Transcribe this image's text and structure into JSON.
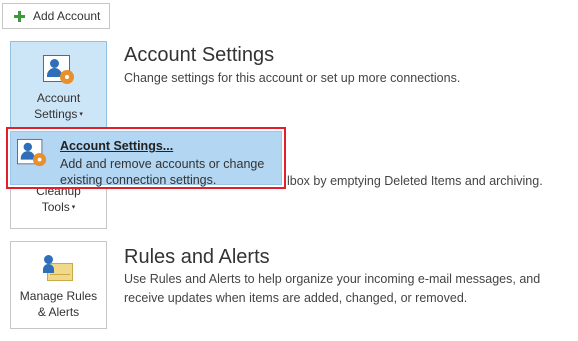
{
  "add_account": {
    "label": "Add Account",
    "icon": "plus-icon",
    "icon_color": "#3c9a3c"
  },
  "account_settings_tile": {
    "label_line1": "Account",
    "label_line2": "Settings",
    "caret": "▾",
    "icon": "person-gear-icon"
  },
  "account_settings_section": {
    "title": "Account Settings",
    "description": "Change settings for this account or set up more connections."
  },
  "dropdown": {
    "item_title": "Account Settings...",
    "item_description": "Add and remove accounts or change existing connection settings.",
    "highlight_color": "#e0202c"
  },
  "cleanup_tile": {
    "label_line1": "Cleanup",
    "label_line2": "Tools",
    "caret": "▾"
  },
  "cleanup_section": {
    "description_fragment": "lbox by emptying Deleted Items and archiving."
  },
  "rules_tile": {
    "label_line1": "Manage Rules",
    "label_line2": "& Alerts",
    "icon": "rules-envelope-icon"
  },
  "rules_section": {
    "title": "Rules and Alerts",
    "description": "Use Rules and Alerts to help organize your incoming e-mail messages, and receive updates when items are added, changed, or removed."
  }
}
